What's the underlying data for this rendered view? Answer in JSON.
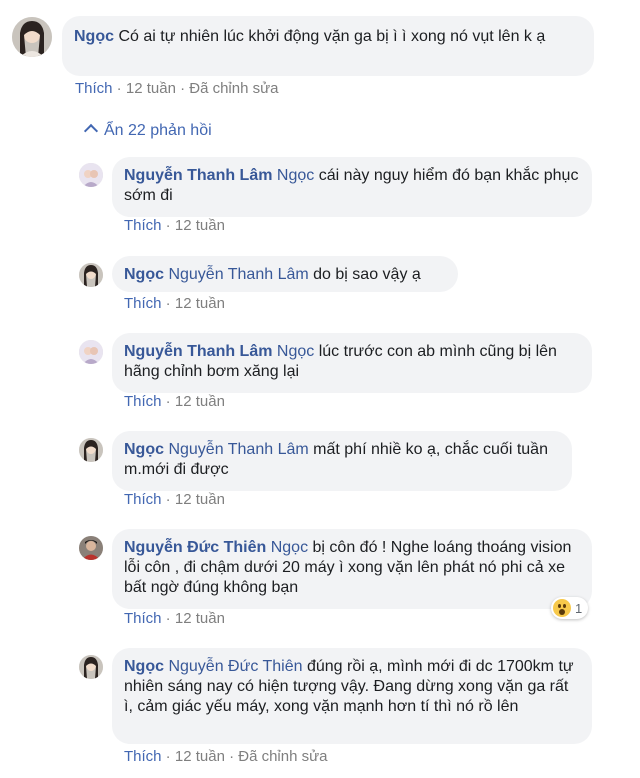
{
  "main_comment": {
    "author": "Ngọc",
    "text": "Có ai tự nhiên lúc khởi động vặn ga bị ì ì xong nó vụt lên k ạ",
    "like_label": "Thích",
    "time": "12 tuần",
    "edited": "Đã chỉnh sửa"
  },
  "toggle": {
    "label": "Ẩn 22 phản hồi"
  },
  "replies": [
    {
      "author": "Nguyễn Thanh Lâm",
      "tag": "Ngọc",
      "text": "cái này nguy hiểm đó bạn khắc phục sớm đi",
      "like_label": "Thích",
      "time": "12 tuần"
    },
    {
      "author": "Ngọc",
      "tag": "Nguyễn Thanh Lâm",
      "text": "do bị sao vậy ạ",
      "like_label": "Thích",
      "time": "12 tuần"
    },
    {
      "author": "Nguyễn Thanh Lâm",
      "tag": "Ngọc",
      "text": "lúc trước con ab mình cũng bị lên hãng chỉnh bơm xăng lại",
      "like_label": "Thích",
      "time": "12 tuần"
    },
    {
      "author": "Ngọc",
      "tag": "Nguyễn Thanh Lâm",
      "text": "mất phí nhiề ko ạ, chắc cuối tuần m.mới đi được",
      "like_label": "Thích",
      "time": "12 tuần"
    },
    {
      "author": "Nguyễn Đức Thiên",
      "tag": "Ngọc",
      "text": "bị côn đó ! Nghe loáng thoáng vision lỗi côn , đi chậm dưới 20 máy ì xong vặn lên phát nó phi cả xe bất ngờ đúng không bạn",
      "like_label": "Thích",
      "time": "12 tuần",
      "reaction_count": "1"
    },
    {
      "author": "Ngọc",
      "tag": "Nguyễn Đức Thiên",
      "text": "đúng rồi ạ, mình mới đi dc 1700km tự nhiên sáng nay có hiện tượng vậy. Đang dừng xong vặn ga rất ì, cảm giác yếu máy, xong vặn mạnh hơn tí thì nó rồ lên",
      "like_label": "Thích",
      "time": "12 tuần",
      "edited": "Đã chỉnh sửa"
    }
  ],
  "colors": {
    "name": "#385898",
    "link": "#4267b2",
    "bubble": "#f2f3f5",
    "meta": "#7f7f7f"
  }
}
